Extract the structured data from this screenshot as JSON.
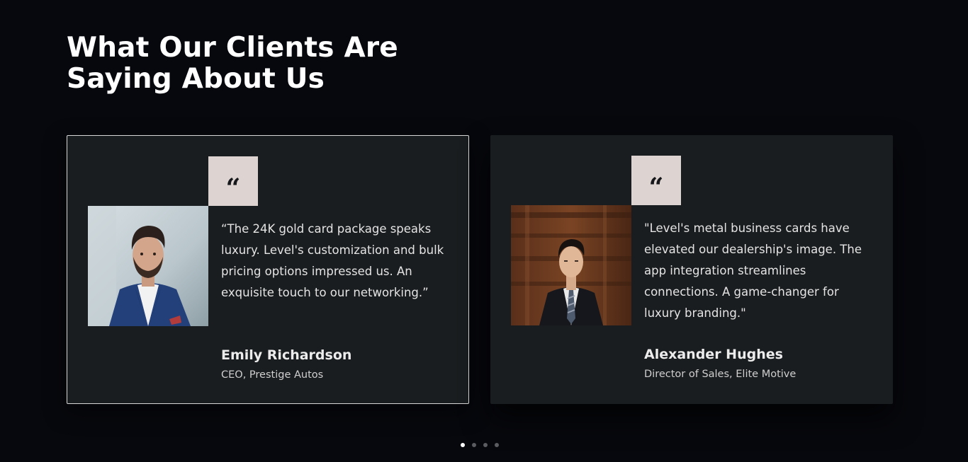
{
  "section": {
    "title": "What Our Clients Are Saying About Us"
  },
  "testimonials": [
    {
      "quote_icon": "quote-icon",
      "quote_glyph": "“",
      "text": "“The 24K gold card package speaks luxury. Level's customization and bulk pricing options impressed us. An exquisite touch to our networking.”",
      "name": "Emily Richardson",
      "role": "CEO, Prestige Autos",
      "active": true
    },
    {
      "quote_icon": "quote-icon",
      "quote_glyph": "“",
      "text": "\"Level's metal business cards have elevated our dealership's image. The app integration streamlines connections. A game-changer for luxury branding.\"",
      "name": "Alexander Hughes",
      "role": "Director of Sales, Elite Motive",
      "active": false
    }
  ],
  "pagination": {
    "count": 4,
    "active_index": 0
  },
  "colors": {
    "background": "#07080d",
    "card": "#1a1d1f",
    "quote_badge": "#ddd3d0",
    "active_border": "#d7d7d7",
    "dot_active": "#ffffff",
    "dot_inactive": "#5a5c62"
  }
}
